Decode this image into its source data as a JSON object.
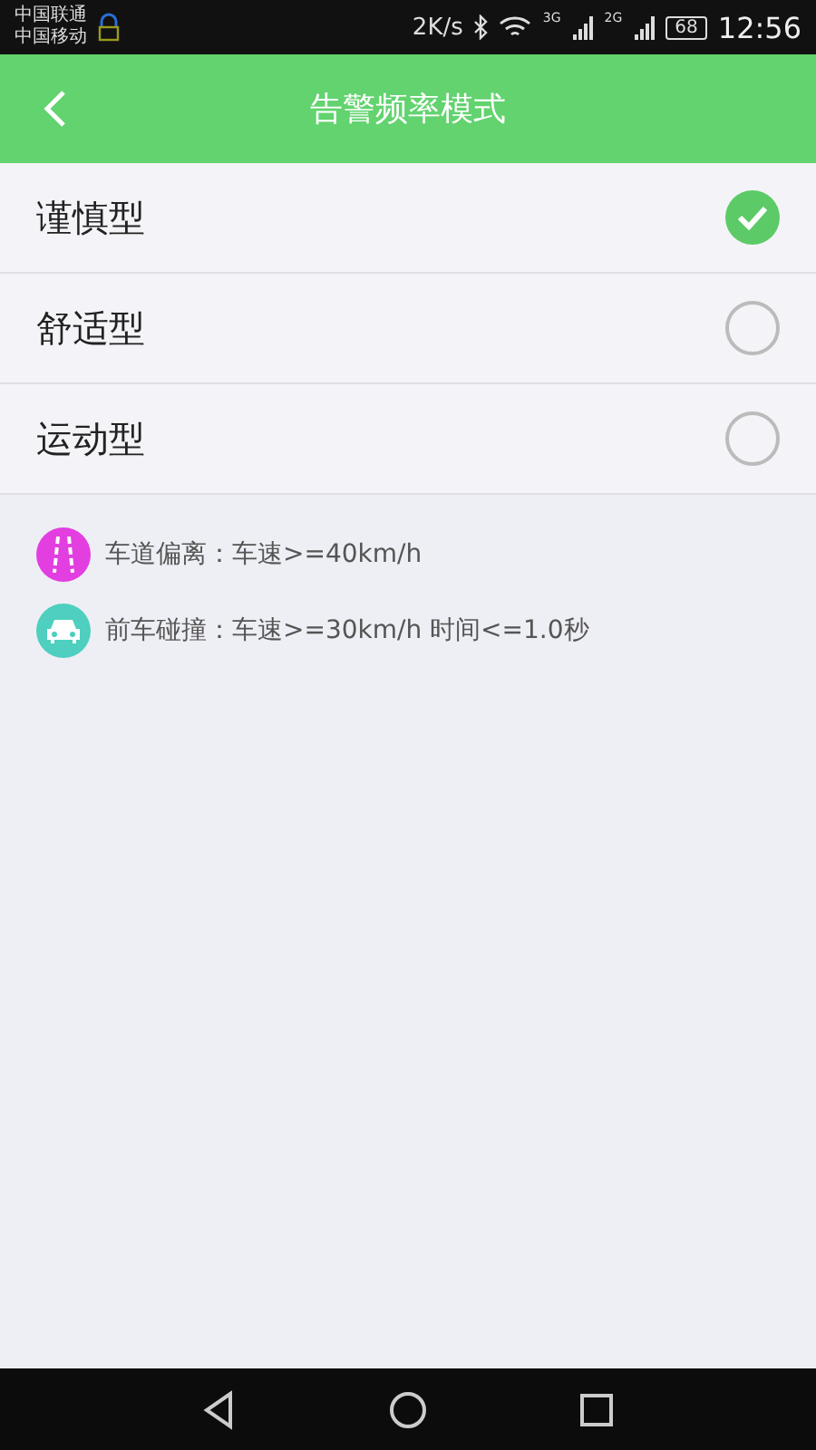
{
  "status_bar": {
    "carriers": [
      "中国联通",
      "中国移动"
    ],
    "speed": "2K/s",
    "net_1": "3G",
    "net_2": "2G",
    "battery": "68",
    "time": "12:56"
  },
  "header": {
    "title": "告警频率模式"
  },
  "modes": [
    {
      "label": "谨慎型",
      "selected": true
    },
    {
      "label": "舒适型",
      "selected": false
    },
    {
      "label": "运动型",
      "selected": false
    }
  ],
  "info": [
    {
      "kind": "lane",
      "color": "#e23ee0",
      "text": "车道偏离：车速>=40km/h"
    },
    {
      "kind": "car",
      "color": "#4ecfbf",
      "text": "前车碰撞：车速>=30km/h 时间<=1.0秒"
    }
  ]
}
